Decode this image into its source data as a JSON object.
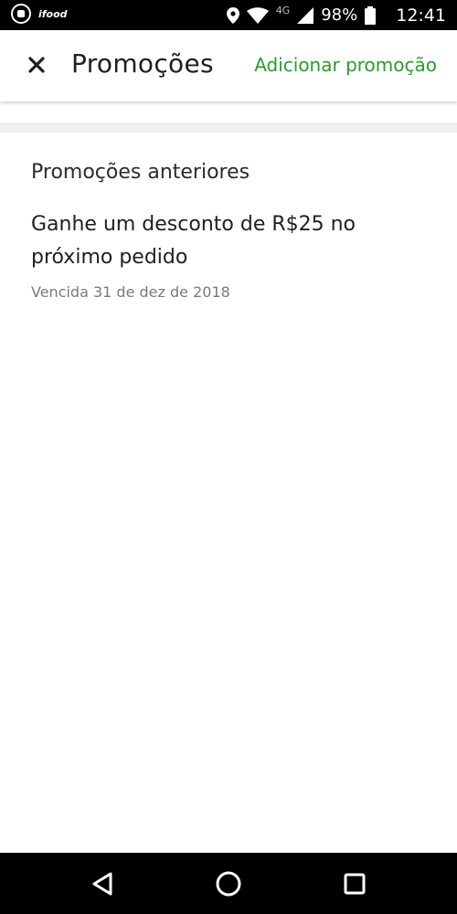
{
  "status_bar": {
    "left_icons": [
      "whatsapp-icon",
      "app-notification-icon"
    ],
    "app_badge_text": "ifood",
    "network_label": "4G",
    "battery_percent": "98%",
    "time": "12:41"
  },
  "header": {
    "title": "Promoções",
    "action_label": "Adicionar promoção",
    "close_icon": "close-icon"
  },
  "content": {
    "section_title": "Promoções anteriores",
    "promos": [
      {
        "title": "Ganhe um desconto de R$25 no próximo pedido",
        "expiry": "Vencida 31 de dez de 2018"
      }
    ]
  },
  "nav_bar": {
    "icons": [
      "back-icon",
      "home-icon",
      "recents-icon"
    ]
  },
  "colors": {
    "accent": "#2a9d2a",
    "status_bar_bg": "#000000",
    "nav_bar_bg": "#000000",
    "title_text": "#1f1f1f",
    "secondary_text": "#7a7a7a"
  }
}
